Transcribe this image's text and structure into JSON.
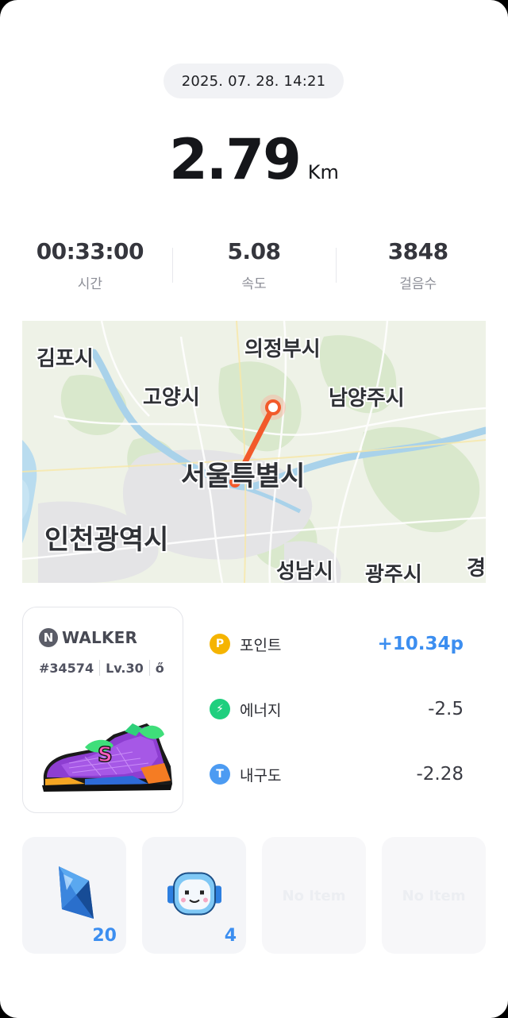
{
  "session": {
    "datetime": "2025. 07. 28. 14:21",
    "distance_value": "2.79",
    "distance_unit": "Km"
  },
  "stats": [
    {
      "value": "00:33:00",
      "label": "시간"
    },
    {
      "value": "5.08",
      "label": "속도"
    },
    {
      "value": "3848",
      "label": "걸음수"
    }
  ],
  "map": {
    "labels": {
      "gimpo": "김포시",
      "uijeongbu": "의정부시",
      "goyang": "고양시",
      "namyangju": "남양주시",
      "seoul": "서울특별시",
      "incheon": "인천광역시",
      "seongnam": "성남시",
      "gwangju": "광주시",
      "gyeong": "경"
    },
    "route_color": "#f25a2b"
  },
  "nft": {
    "brand_letter": "N",
    "brand_name": "WALKER",
    "id": "#34574",
    "level": "Lv.30",
    "extra": "ő"
  },
  "metrics": [
    {
      "icon": "point-icon",
      "symbol": "P",
      "color": "#f5b400",
      "label": "포인트",
      "value": "+10.34p"
    },
    {
      "icon": "energy-icon",
      "symbol": "⚡",
      "color": "#1fcf7e",
      "label": "에너지",
      "value": "-2.5"
    },
    {
      "icon": "durability-icon",
      "symbol": "T",
      "color": "#4c9bf2",
      "label": "내구도",
      "value": "-2.28"
    }
  ],
  "items": [
    {
      "icon": "crystal-icon",
      "count": "20"
    },
    {
      "icon": "robot-head-icon",
      "count": "4"
    },
    {
      "label": "No Item"
    },
    {
      "label": "No Item"
    }
  ]
}
